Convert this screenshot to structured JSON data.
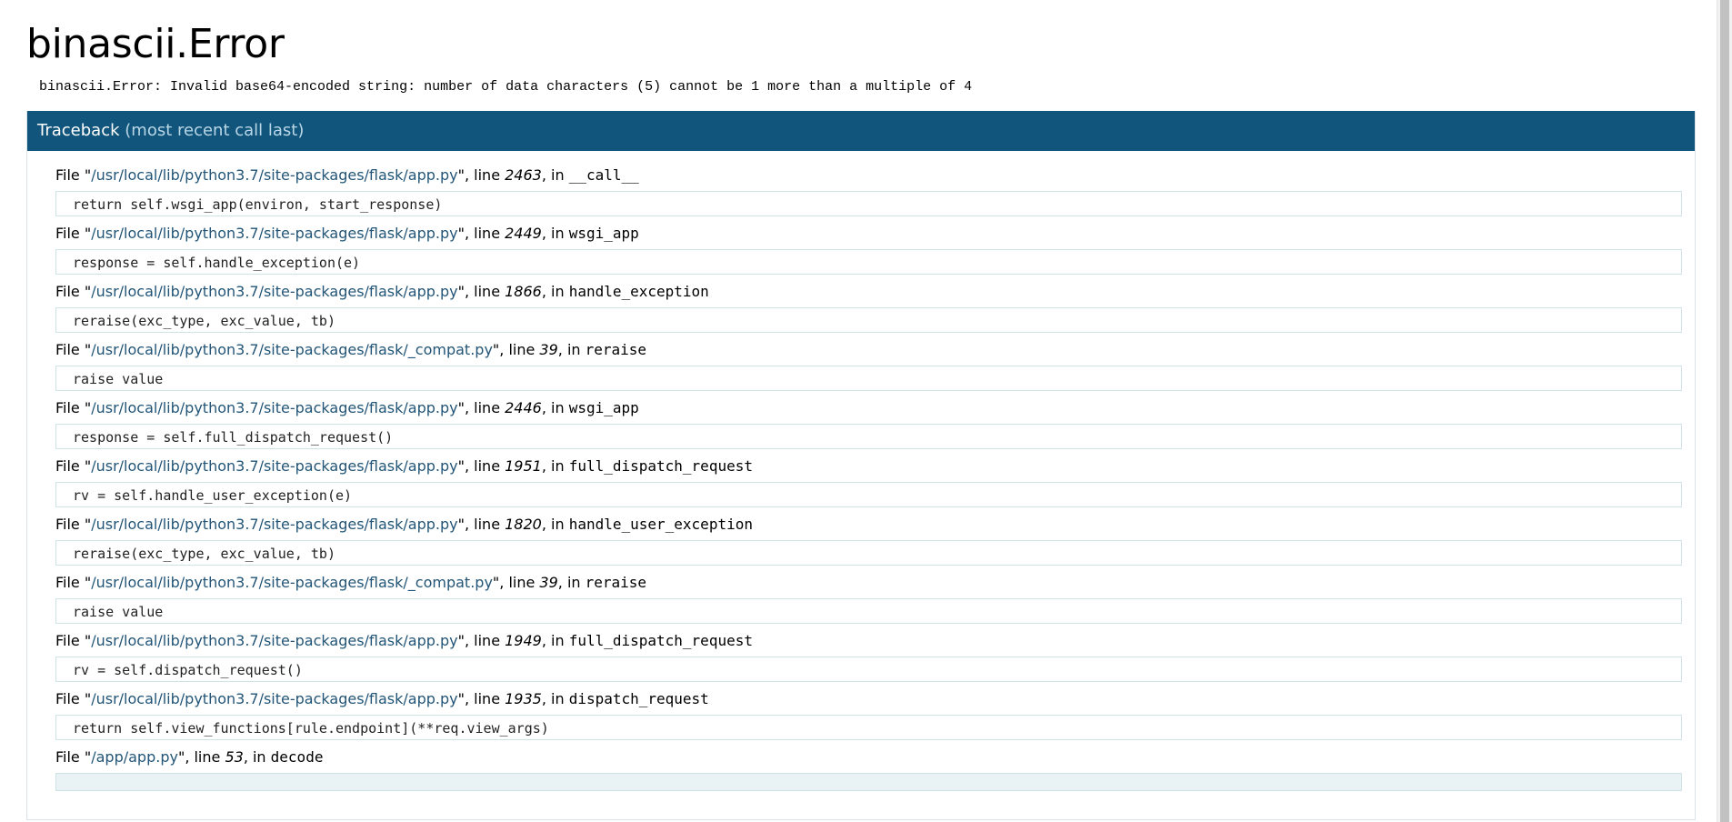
{
  "error": {
    "title": "binascii.Error",
    "message": "binascii.Error: Invalid base64-encoded string: number of data characters (5) cannot be 1 more than a multiple of 4"
  },
  "traceback": {
    "header": "Traceback",
    "header_note": "(most recent call last)",
    "frames": [
      {
        "prefix": "File \"",
        "file": "/usr/local/lib/python3.7/site-packages/flask/app.py",
        "mid": "\", line ",
        "line": "2463",
        "in": ", in ",
        "func": "__call__",
        "code": "return self.wsgi_app(environ, start_response)"
      },
      {
        "prefix": "File \"",
        "file": "/usr/local/lib/python3.7/site-packages/flask/app.py",
        "mid": "\", line ",
        "line": "2449",
        "in": ", in ",
        "func": "wsgi_app",
        "code": "response = self.handle_exception(e)"
      },
      {
        "prefix": "File \"",
        "file": "/usr/local/lib/python3.7/site-packages/flask/app.py",
        "mid": "\", line ",
        "line": "1866",
        "in": ", in ",
        "func": "handle_exception",
        "code": "reraise(exc_type, exc_value, tb)"
      },
      {
        "prefix": "File \"",
        "file": "/usr/local/lib/python3.7/site-packages/flask/_compat.py",
        "mid": "\", line ",
        "line": "39",
        "in": ", in ",
        "func": "reraise",
        "code": "raise value"
      },
      {
        "prefix": "File \"",
        "file": "/usr/local/lib/python3.7/site-packages/flask/app.py",
        "mid": "\", line ",
        "line": "2446",
        "in": ", in ",
        "func": "wsgi_app",
        "code": "response = self.full_dispatch_request()"
      },
      {
        "prefix": "File \"",
        "file": "/usr/local/lib/python3.7/site-packages/flask/app.py",
        "mid": "\", line ",
        "line": "1951",
        "in": ", in ",
        "func": "full_dispatch_request",
        "code": "rv = self.handle_user_exception(e)"
      },
      {
        "prefix": "File \"",
        "file": "/usr/local/lib/python3.7/site-packages/flask/app.py",
        "mid": "\", line ",
        "line": "1820",
        "in": ", in ",
        "func": "handle_user_exception",
        "code": "reraise(exc_type, exc_value, tb)"
      },
      {
        "prefix": "File \"",
        "file": "/usr/local/lib/python3.7/site-packages/flask/_compat.py",
        "mid": "\", line ",
        "line": "39",
        "in": ", in ",
        "func": "reraise",
        "code": "raise value"
      },
      {
        "prefix": "File \"",
        "file": "/usr/local/lib/python3.7/site-packages/flask/app.py",
        "mid": "\", line ",
        "line": "1949",
        "in": ", in ",
        "func": "full_dispatch_request",
        "code": "rv = self.dispatch_request()"
      },
      {
        "prefix": "File \"",
        "file": "/usr/local/lib/python3.7/site-packages/flask/app.py",
        "mid": "\", line ",
        "line": "1935",
        "in": ", in ",
        "func": "dispatch_request",
        "code": "return self.view_functions[rule.endpoint](**req.view_args)"
      },
      {
        "prefix": "File \"",
        "file": "/app/app.py",
        "mid": "\", line ",
        "line": "53",
        "in": ", in ",
        "func": "decode",
        "code": ""
      }
    ]
  },
  "colors": {
    "header_bg": "#11557c",
    "header_note": "#b9d6e6",
    "filename": "#225577",
    "code_border": "#cfe3e6"
  }
}
